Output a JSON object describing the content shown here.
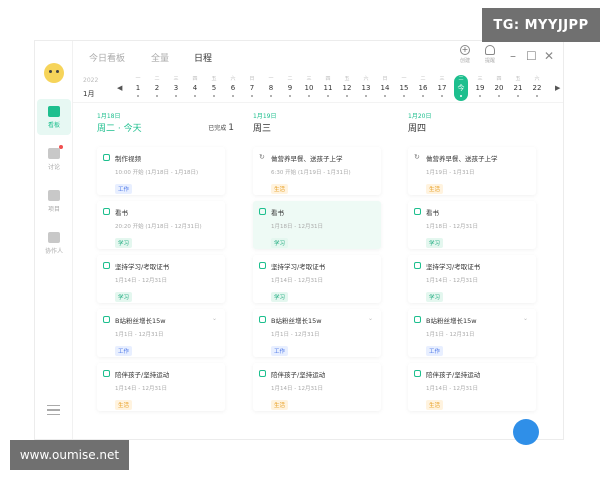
{
  "overlay": {
    "tg": "TG: MYYJJPP",
    "site": "www.oumise.net"
  },
  "header": {
    "tabs": [
      {
        "label": "今日看板"
      },
      {
        "label": "全量"
      },
      {
        "label": "日程"
      }
    ],
    "create_label": "创建",
    "remind_label": "提醒"
  },
  "sidebar": {
    "items": [
      {
        "label": "看板"
      },
      {
        "label": "讨论"
      },
      {
        "label": "项目"
      },
      {
        "label": "协作人"
      }
    ]
  },
  "datestrip": {
    "year": "2022",
    "month": "1月",
    "days": [
      {
        "w": "一",
        "n": "1"
      },
      {
        "w": "二",
        "n": "2"
      },
      {
        "w": "三",
        "n": "3"
      },
      {
        "w": "四",
        "n": "4"
      },
      {
        "w": "五",
        "n": "5"
      },
      {
        "w": "六",
        "n": "6"
      },
      {
        "w": "日",
        "n": "7"
      },
      {
        "w": "一",
        "n": "8"
      },
      {
        "w": "二",
        "n": "9"
      },
      {
        "w": "三",
        "n": "10"
      },
      {
        "w": "四",
        "n": "11"
      },
      {
        "w": "五",
        "n": "12"
      },
      {
        "w": "六",
        "n": "13"
      },
      {
        "w": "日",
        "n": "14"
      },
      {
        "w": "一",
        "n": "15"
      },
      {
        "w": "二",
        "n": "16"
      },
      {
        "w": "三",
        "n": "17"
      },
      {
        "w": "二",
        "n": "今"
      },
      {
        "w": "三",
        "n": "19"
      },
      {
        "w": "四",
        "n": "20"
      },
      {
        "w": "五",
        "n": "21"
      },
      {
        "w": "六",
        "n": "22"
      }
    ]
  },
  "columns": [
    {
      "date": "1月18日",
      "week": "周二 · 今天",
      "done_label": "已完成",
      "done_count": "1",
      "cards": [
        {
          "title": "制作视频",
          "meta": "10:00 开始 (1月18日 - 1月18日)",
          "tag": "工作",
          "tag_type": "work"
        },
        {
          "title": "看书",
          "meta": "20:20 开始 (1月18日 - 12月31日)",
          "tag": "学习",
          "tag_type": "study"
        },
        {
          "title": "坚持学习/考取证书",
          "meta": "1月14日 - 12月31日",
          "tag": "学习",
          "tag_type": "study"
        },
        {
          "title": "B站粉丝增长15w",
          "meta": "1月1日 - 12月31日",
          "tag": "工作",
          "tag_type": "work"
        },
        {
          "title": "陪伴孩子/坚持运动",
          "meta": "1月14日 - 12月31日",
          "tag": "生活",
          "tag_type": "life"
        }
      ]
    },
    {
      "date": "1月19日",
      "week": "周三",
      "cards": [
        {
          "title": "做营养早餐、送孩子上学",
          "meta": "6:30 开始 (1月19日 - 1月31日)",
          "tag": "生活",
          "tag_type": "life"
        },
        {
          "title": "看书",
          "meta": "1月18日 - 12月31日",
          "tag": "学习",
          "tag_type": "study"
        },
        {
          "title": "坚持学习/考取证书",
          "meta": "1月14日 - 12月31日",
          "tag": "学习",
          "tag_type": "study"
        },
        {
          "title": "B站粉丝增长15w",
          "meta": "1月1日 - 12月31日",
          "tag": "工作",
          "tag_type": "work"
        },
        {
          "title": "陪伴孩子/坚持运动",
          "meta": "1月14日 - 12月31日",
          "tag": "生活",
          "tag_type": "life"
        }
      ]
    },
    {
      "date": "1月20日",
      "week": "周四",
      "cards": [
        {
          "title": "做营养早餐、送孩子上学",
          "meta": "1月19日 - 1月31日",
          "tag": "生活",
          "tag_type": "life"
        },
        {
          "title": "看书",
          "meta": "1月18日 - 12月31日",
          "tag": "学习",
          "tag_type": "study"
        },
        {
          "title": "坚持学习/考取证书",
          "meta": "1月14日 - 12月31日",
          "tag": "学习",
          "tag_type": "study"
        },
        {
          "title": "B站粉丝增长15w",
          "meta": "1月1日 - 12月31日",
          "tag": "工作",
          "tag_type": "work"
        },
        {
          "title": "陪伴孩子/坚持运动",
          "meta": "1月14日 - 12月31日",
          "tag": "生活",
          "tag_type": "life"
        }
      ]
    }
  ],
  "colors": {
    "accent": "#1dbf8e",
    "work": "#4a76e8",
    "study": "#1dab7e",
    "life": "#e69a1a"
  }
}
